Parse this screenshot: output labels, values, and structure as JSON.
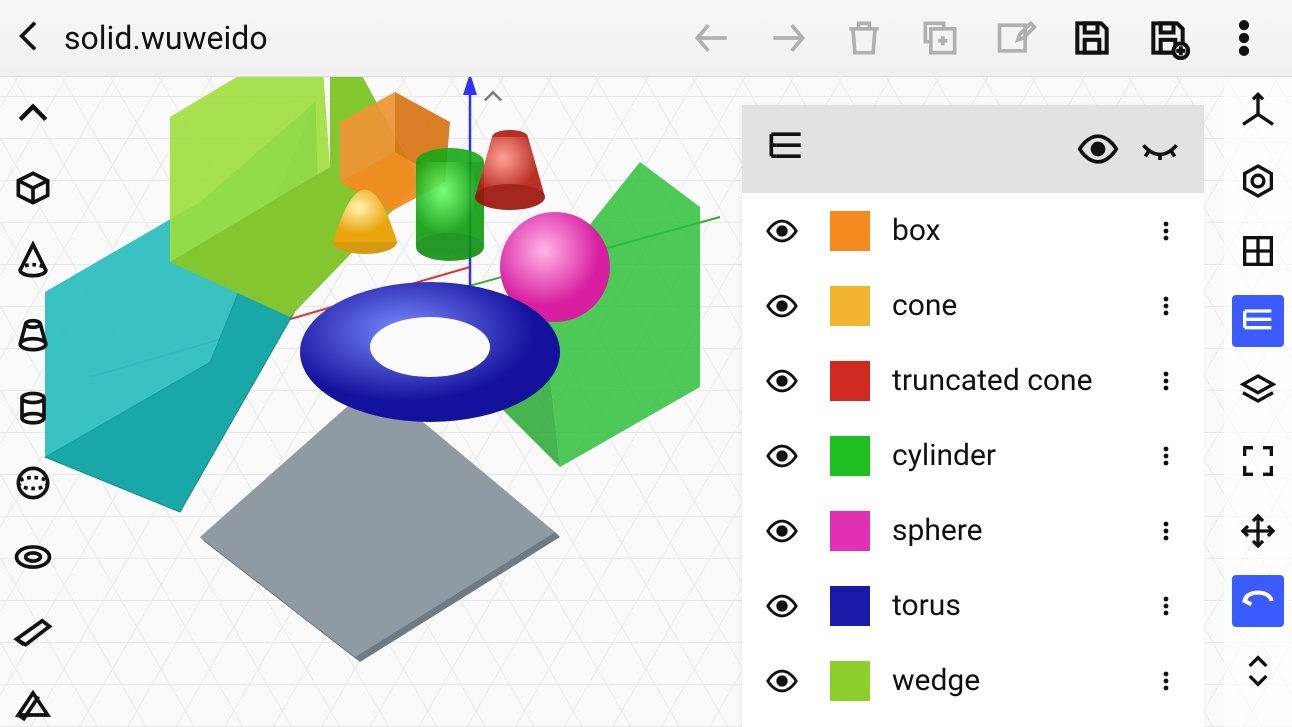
{
  "filename": "solid.wuweido",
  "objects": [
    {
      "name": "box",
      "color": "#f58a1f",
      "visible": true
    },
    {
      "name": "cone",
      "color": "#f2b430",
      "visible": true
    },
    {
      "name": "truncated cone",
      "color": "#cf2a20",
      "visible": true
    },
    {
      "name": "cylinder",
      "color": "#1fbf20",
      "visible": true
    },
    {
      "name": "sphere",
      "color": "#e030b4",
      "visible": true
    },
    {
      "name": "torus",
      "color": "#1b19a8",
      "visible": true
    },
    {
      "name": "wedge",
      "color": "#8cce2b",
      "visible": true
    }
  ],
  "colors": {
    "accent": "#3b5bff",
    "axis_x": "#e63030",
    "axis_y": "#3030ff",
    "axis_z": "#30b030"
  },
  "left_tools": [
    "collapse-up",
    "box-tool",
    "cone-tool",
    "truncated-cone-tool",
    "cylinder-tool",
    "sphere-tool",
    "torus-tool",
    "wedge-tool",
    "prism-tool"
  ],
  "right_tools": [
    {
      "id": "axes-icon",
      "active": false
    },
    {
      "id": "view-frame-icon",
      "active": false
    },
    {
      "id": "grid-icon",
      "active": false
    },
    {
      "id": "outline-icon",
      "active": true
    },
    {
      "id": "layers-icon",
      "active": false
    },
    {
      "id": "fullscreen-icon",
      "active": false
    },
    {
      "id": "move-icon",
      "active": false
    },
    {
      "id": "undo-icon",
      "active": true
    },
    {
      "id": "sort-icon",
      "active": false
    }
  ],
  "header_actions": [
    {
      "id": "back-arrow-icon",
      "enabled": false
    },
    {
      "id": "forward-arrow-icon",
      "enabled": false
    },
    {
      "id": "delete-icon",
      "enabled": false
    },
    {
      "id": "duplicate-icon",
      "enabled": false
    },
    {
      "id": "edit-icon",
      "enabled": false
    },
    {
      "id": "save-icon",
      "enabled": true
    },
    {
      "id": "save-as-icon",
      "enabled": true
    },
    {
      "id": "more-menu-icon",
      "enabled": true
    }
  ]
}
